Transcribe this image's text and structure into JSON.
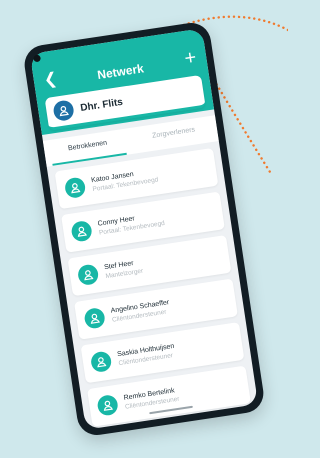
{
  "appbar": {
    "title": "Netwerk",
    "back_icon": "chevron-left-icon",
    "add_icon": "plus-icon"
  },
  "profile": {
    "name": "Dhr. Flits",
    "avatar_icon": "person-icon"
  },
  "tabs": [
    {
      "label": "Betrokkenen",
      "active": true
    },
    {
      "label": "Zorgverleners",
      "active": false
    }
  ],
  "contacts": [
    {
      "name": "Katoo Jansen",
      "role": "Portaal: Tekenbevoegd"
    },
    {
      "name": "Conny Heer",
      "role": "Portaal: Tekenbevoegd"
    },
    {
      "name": "Stef Heer",
      "role": "Mantelzorger"
    },
    {
      "name": "Angelino Schaeffer",
      "role": "Cliëntondersteuner"
    },
    {
      "name": "Saskia Holthuijsen",
      "role": "Cliëntondersteuner"
    },
    {
      "name": "Remko Bertelink",
      "role": "Cliëntondersteuner"
    }
  ],
  "colors": {
    "accent": "#18b7a6",
    "profile_avatar": "#1d6fa5",
    "background": "#cfe8ec",
    "arrow": "#f07a2e"
  }
}
